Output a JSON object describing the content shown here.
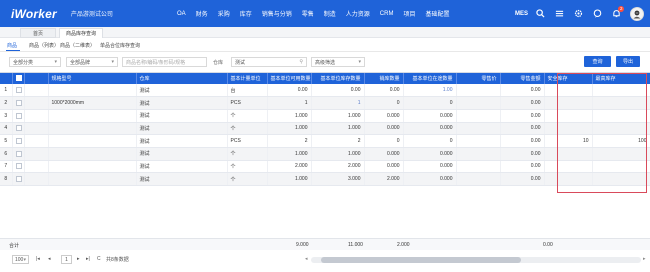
{
  "app": {
    "logo": "iWorker",
    "company": "产品游测试公司",
    "nav": [
      "OA",
      "财务",
      "采购",
      "库存",
      "销售与分销",
      "零售",
      "制造",
      "人力资源",
      "CRM",
      "项目",
      "基础配置"
    ],
    "mes_label": "MES",
    "notification_count": "2"
  },
  "page_tabs": [
    "首页",
    "商品库存查询"
  ],
  "sub_tabs": [
    "商品",
    "商品（列表）",
    "商品（二维表）",
    "单品合位库存查询"
  ],
  "filters": {
    "category": "全部分类",
    "brand": "全部品牌",
    "search_placeholder": "商品名称/编码/条形码/规格",
    "warehouse_label": "仓库",
    "warehouse_value": "测试",
    "advanced": "高级筛选",
    "query_button": "查询",
    "export_button": "导出"
  },
  "table": {
    "columns": [
      "",
      "",
      "规格型号",
      "仓库",
      "基本计量单位",
      "基本单位可用数量",
      "基本单位库存数量",
      "销库数量",
      "基本单位在途数量",
      "零售价",
      "零售金额",
      "安全库存",
      "最高库存"
    ],
    "rows": [
      {
        "no": "1",
        "spec": "",
        "wh": "测试",
        "unit": "台",
        "avail": "0.00",
        "stock": "0.00",
        "sale": "0.00",
        "transit": "1.00",
        "price": "",
        "amount": "0.00",
        "safe": "",
        "max": ""
      },
      {
        "no": "2",
        "spec": "1000*2000mm",
        "wh": "测试",
        "unit": "PCS",
        "avail": "1",
        "stock": "1",
        "sale": "0",
        "transit": "0",
        "price": "",
        "amount": "0.00",
        "safe": "",
        "max": ""
      },
      {
        "no": "3",
        "spec": "",
        "wh": "测试",
        "unit": "个",
        "avail": "1.000",
        "stock": "1.000",
        "sale": "0.000",
        "transit": "0.000",
        "price": "",
        "amount": "0.00",
        "safe": "",
        "max": ""
      },
      {
        "no": "4",
        "spec": "",
        "wh": "测试",
        "unit": "个",
        "avail": "1.000",
        "stock": "1.000",
        "sale": "0.000",
        "transit": "0.000",
        "price": "",
        "amount": "0.00",
        "safe": "",
        "max": ""
      },
      {
        "no": "5",
        "spec": "",
        "wh": "测试",
        "unit": "PCS",
        "avail": "2",
        "stock": "2",
        "sale": "0",
        "transit": "0",
        "price": "",
        "amount": "0.00",
        "safe": "10",
        "max": "100"
      },
      {
        "no": "6",
        "spec": "",
        "wh": "测试",
        "unit": "个",
        "avail": "1.000",
        "stock": "1.000",
        "sale": "0.000",
        "transit": "0.000",
        "price": "",
        "amount": "0.00",
        "safe": "",
        "max": ""
      },
      {
        "no": "7",
        "spec": "",
        "wh": "测试",
        "unit": "个",
        "avail": "2.000",
        "stock": "2.000",
        "sale": "0.000",
        "transit": "0.000",
        "price": "",
        "amount": "0.00",
        "safe": "",
        "max": ""
      },
      {
        "no": "8",
        "spec": "",
        "wh": "测试",
        "unit": "个",
        "avail": "1.000",
        "stock": "3.000",
        "sale": "2.000",
        "transit": "0.000",
        "price": "",
        "amount": "0.00",
        "safe": "",
        "max": ""
      }
    ],
    "totals": {
      "label": "合计",
      "avail": "9.000",
      "stock": "11.000",
      "sale": "2.000",
      "amount": "0.00"
    }
  },
  "pager": {
    "page_size": "100",
    "current_page": "1",
    "total_text": "共8条数据"
  }
}
